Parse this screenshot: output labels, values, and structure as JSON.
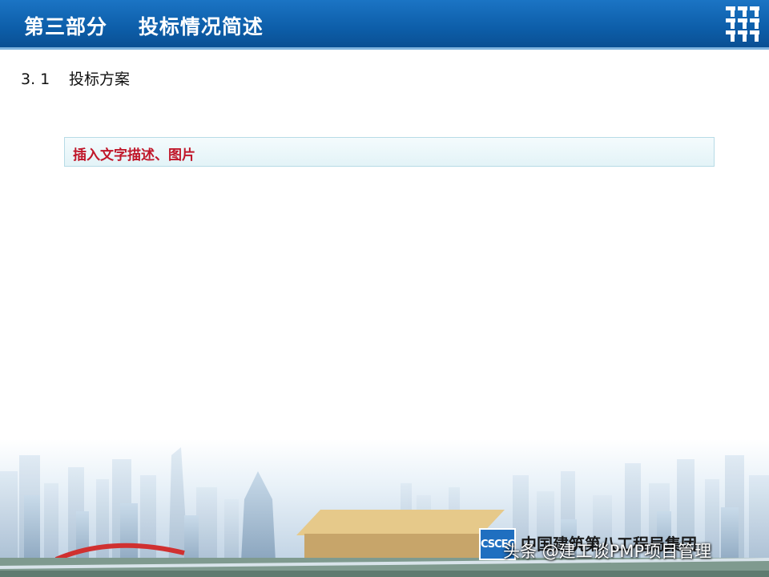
{
  "header": {
    "title": "第三部分    投标情况简述",
    "logo_icon": "company-grid-logo-icon"
  },
  "section": {
    "number": "3. 1",
    "title": "投标方案"
  },
  "note": {
    "text": "插入文字描述、图片"
  },
  "footer": {
    "company_logo_text": "CSCEC",
    "company_name": "中国建筑第八工程局集团",
    "watermark": "头条 @建工谈PMP项目管理"
  },
  "colors": {
    "header_blue": "#0d5ea9",
    "note_red": "#c0172a",
    "note_bg": "#e3f3f7"
  }
}
